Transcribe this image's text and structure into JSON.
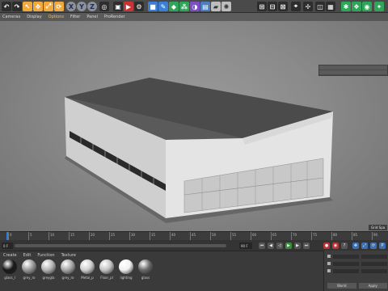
{
  "toolbar": {
    "axis_x": "X",
    "axis_y": "Y",
    "axis_z": "Z",
    "icons": [
      "undo-icon",
      "redo-icon",
      "live-select-icon",
      "move-icon",
      "scale-icon",
      "rotate-icon",
      "recent-tool-icon",
      "axis-x-icon",
      "axis-y-icon",
      "axis-z-icon",
      "world-coords-icon",
      "render-view-icon",
      "render-picture-icon",
      "render-settings-icon",
      "cube-icon",
      "pen-icon",
      "subdivision-icon",
      "array-icon",
      "deformer-icon",
      "scene-icon",
      "camera-icon",
      "light-icon"
    ]
  },
  "viewport": {
    "menu": [
      "Cameras",
      "Display",
      "Options",
      "Filter",
      "Panel",
      "ProRender"
    ],
    "active_menu_index": 2,
    "grid_label": "Grid Spa"
  },
  "timeline": {
    "ticks": [
      "0",
      "5",
      "10",
      "15",
      "20",
      "25",
      "30",
      "35",
      "40",
      "45",
      "50",
      "55",
      "60",
      "65",
      "70",
      "75",
      "80",
      "85",
      "90"
    ],
    "start_field": "0 F",
    "end_field": "90 F",
    "transport_buttons": [
      "first-frame-icon",
      "prev-key-icon",
      "play-back-icon",
      "play-icon",
      "next-key-icon",
      "last-frame-icon"
    ]
  },
  "materials": {
    "menu": [
      "Create",
      "Edit",
      "Function",
      "Texture"
    ],
    "items": [
      {
        "label": "glass_l",
        "color": "#1a1a1a"
      },
      {
        "label": "grey_ro",
        "color": "#9a9a9a"
      },
      {
        "label": "greygla",
        "color": "#b5b5b5"
      },
      {
        "label": "grey_ro",
        "color": "#a8a8a8"
      },
      {
        "label": "Metal_p",
        "color": "#d0d0d0"
      },
      {
        "label": "Floor_pl",
        "color": "#c4c4c4"
      },
      {
        "label": "lighting",
        "color": "#f2f2f2"
      },
      {
        "label": "glass",
        "color": "#6a6a6a"
      }
    ]
  },
  "attributes": {
    "rows": [
      "X",
      "Y",
      "Z"
    ],
    "bottom": [
      "World",
      "Apply"
    ]
  },
  "colors": {
    "accent": "#f2c25c",
    "playhead": "#2d7fd6"
  }
}
